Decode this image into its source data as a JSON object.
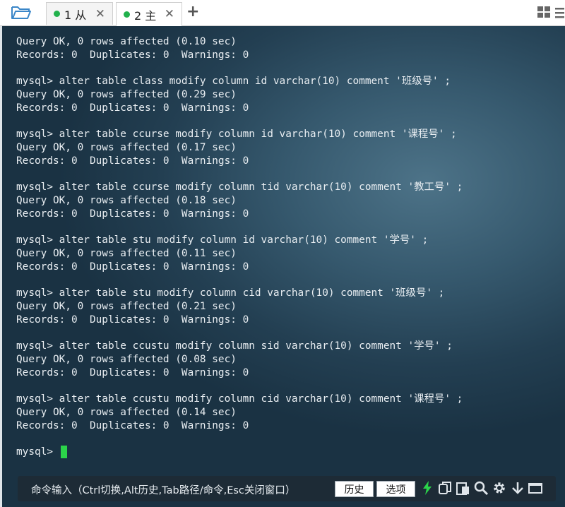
{
  "tabs": [
    {
      "label": "1 从",
      "status_color": "#22b14c"
    },
    {
      "label": "2 主",
      "status_color": "#22b14c"
    }
  ],
  "icons": {
    "folder": "folder-open-icon",
    "add_tab": "+",
    "layout": "grid-layout-icon",
    "menu": "menu-icon"
  },
  "terminal": {
    "lines": [
      "Query OK, 0 rows affected (0.10 sec)",
      "Records: 0  Duplicates: 0  Warnings: 0",
      "",
      "mysql> alter table class modify column id varchar(10) comment '班级号' ;",
      "Query OK, 0 rows affected (0.29 sec)",
      "Records: 0  Duplicates: 0  Warnings: 0",
      "",
      "mysql> alter table ccurse modify column id varchar(10) comment '课程号' ;",
      "Query OK, 0 rows affected (0.17 sec)",
      "Records: 0  Duplicates: 0  Warnings: 0",
      "",
      "mysql> alter table ccurse modify column tid varchar(10) comment '教工号' ;",
      "Query OK, 0 rows affected (0.18 sec)",
      "Records: 0  Duplicates: 0  Warnings: 0",
      "",
      "mysql> alter table stu modify column id varchar(10) comment '学号' ;",
      "Query OK, 0 rows affected (0.11 sec)",
      "Records: 0  Duplicates: 0  Warnings: 0",
      "",
      "mysql> alter table stu modify column cid varchar(10) comment '班级号' ;",
      "Query OK, 0 rows affected (0.21 sec)",
      "Records: 0  Duplicates: 0  Warnings: 0",
      "",
      "mysql> alter table ccustu modify column sid varchar(10) comment '学号' ;",
      "Query OK, 0 rows affected (0.08 sec)",
      "Records: 0  Duplicates: 0  Warnings: 0",
      "",
      "mysql> alter table ccustu modify column cid varchar(10) comment '课程号' ;",
      "Query OK, 0 rows affected (0.14 sec)",
      "Records: 0  Duplicates: 0  Warnings: 0"
    ],
    "prompt": "mysql> ",
    "cursor_color": "#2bd44a"
  },
  "command_bar": {
    "hint": "命令输入（Ctrl切换,Alt历史,Tab路径/命令,Esc关闭窗口）",
    "history_label": "历史",
    "options_label": "选项",
    "icon_names": [
      "lightning-icon",
      "copy-icon",
      "paste-icon",
      "search-icon",
      "gear-icon",
      "download-arrow-icon",
      "window-icon"
    ]
  }
}
